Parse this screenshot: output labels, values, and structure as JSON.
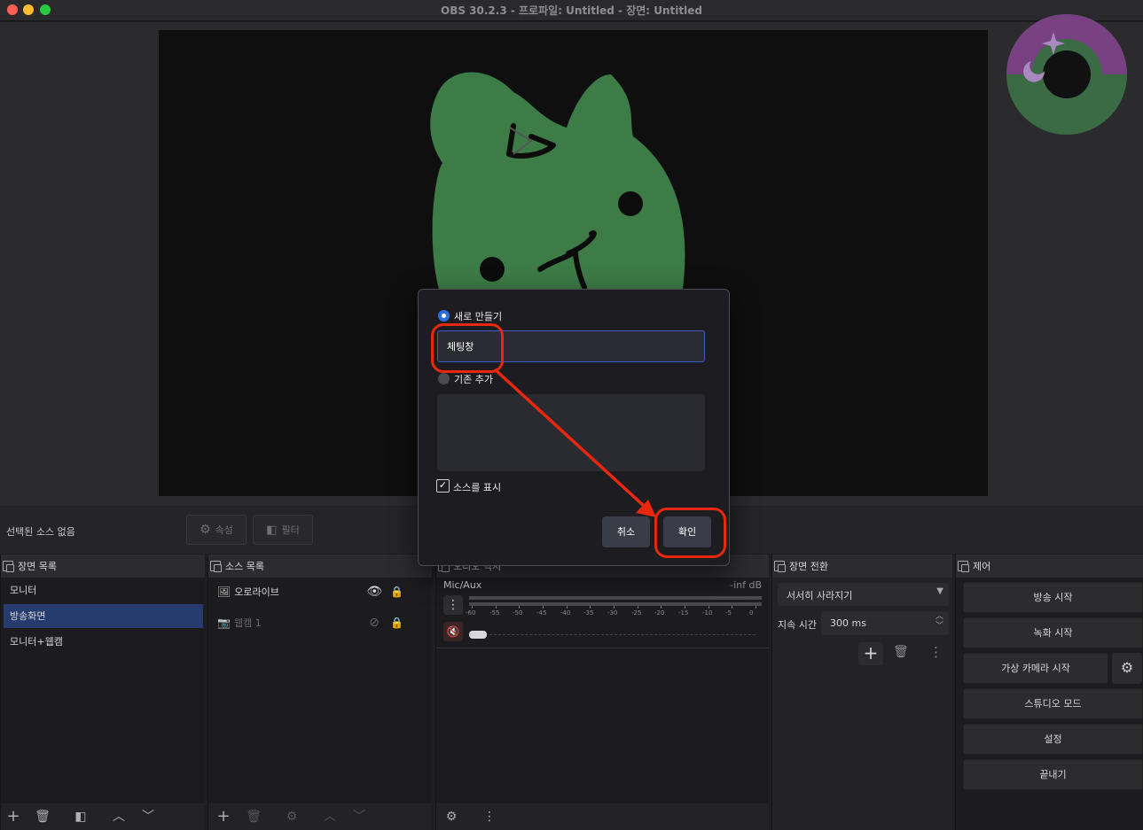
{
  "window": {
    "title": "OBS 30.2.3 - 프로파일: Untitled - 장면: Untitled"
  },
  "context_bar": {
    "no_source": "선택된 소스 없음",
    "properties_label": "속성",
    "filters_label": "필터"
  },
  "scenes_dock": {
    "title": "장면 목록",
    "items": [
      {
        "label": "모니터"
      },
      {
        "label": "방송화면"
      },
      {
        "label": "모니터+웹캠"
      }
    ],
    "selected": "방송화면"
  },
  "sources_dock": {
    "title": "소스 목록",
    "items": [
      {
        "label": "오로라이브",
        "visible": true
      },
      {
        "label": "웹캠 1",
        "visible": false
      }
    ]
  },
  "audio_mixer": {
    "title": "오디오 믹서",
    "channel": "Mic/Aux",
    "level": "-inf dB",
    "ticks": [
      "-60",
      "-55",
      "-50",
      "-45",
      "-40",
      "-35",
      "-30",
      "-25",
      "-20",
      "-15",
      "-10",
      "-5",
      "0"
    ]
  },
  "transitions_dock": {
    "title": "장면 전환",
    "transition": "서서히 사라지기",
    "duration_label": "지속 시간",
    "duration_value": "300 ms"
  },
  "controls_dock": {
    "title": "제어",
    "buttons": [
      "방송 시작",
      "녹화 시작",
      "가상 카메라 시작",
      "스튜디오 모드",
      "설정",
      "끝내기"
    ]
  },
  "dialog": {
    "create_new_label": "새로 만들기",
    "name_value": "체팅창",
    "add_existing_label": "기존 추가",
    "show_source_label": "소스를 표시",
    "show_source_checked": true,
    "cancel_label": "취소",
    "ok_label": "확인"
  },
  "colors": {
    "accent": "#3f5bc8",
    "selection": "#263c6e",
    "annotation": "#e8280e",
    "cat_green": "#3d7b47"
  }
}
